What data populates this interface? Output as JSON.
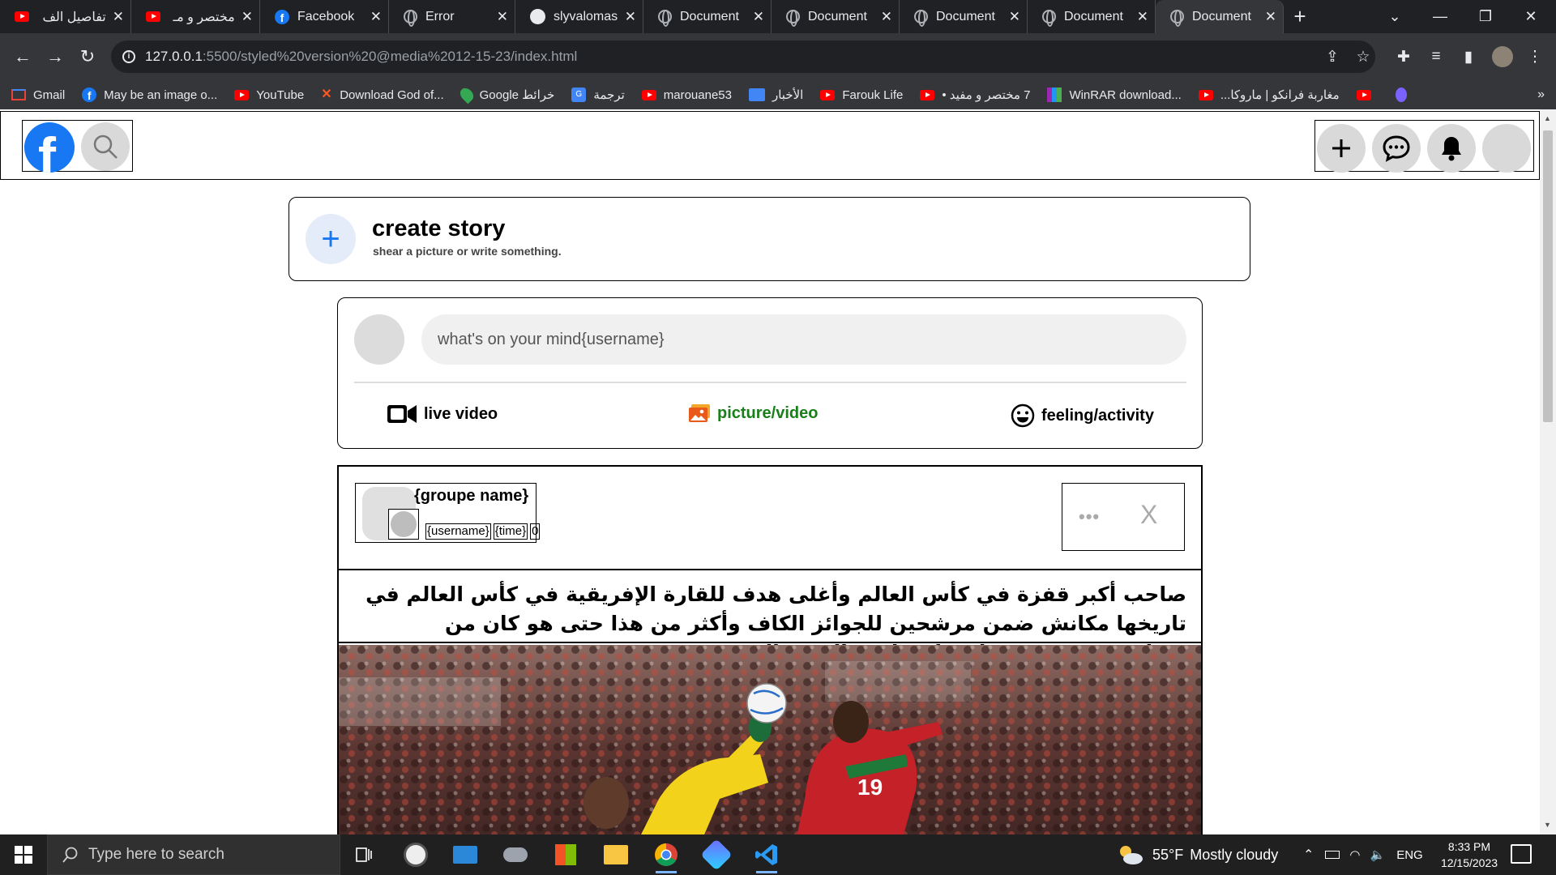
{
  "browser": {
    "tabs": [
      {
        "title": "تفاصيل الف",
        "favicon": "youtube-icon",
        "active": false
      },
      {
        "title": "مختصر و مـ",
        "favicon": "youtube-icon",
        "active": false
      },
      {
        "title": "Facebook",
        "favicon": "facebook-icon",
        "active": false
      },
      {
        "title": "Error",
        "favicon": "globe-icon",
        "active": false
      },
      {
        "title": "slyvalomas",
        "favicon": "github-icon",
        "active": false
      },
      {
        "title": "Document",
        "favicon": "globe-icon",
        "active": false
      },
      {
        "title": "Document",
        "favicon": "globe-icon",
        "active": false
      },
      {
        "title": "Document",
        "favicon": "globe-icon",
        "active": false
      },
      {
        "title": "Document",
        "favicon": "globe-icon",
        "active": false
      },
      {
        "title": "Document",
        "favicon": "globe-icon",
        "active": true
      }
    ],
    "url_host": "127.0.0.1",
    "url_path": ":5500/styled%20version%20@media%2012-15-23/index.html",
    "bookmarks": [
      {
        "label": "Gmail",
        "icon": "gmail-icon"
      },
      {
        "label": "May be an image o...",
        "icon": "facebook-icon"
      },
      {
        "label": "YouTube",
        "icon": "youtube-icon"
      },
      {
        "label": "Download God of...",
        "icon": "download-icon"
      },
      {
        "label": "Google خرائط",
        "icon": "maps-icon"
      },
      {
        "label": "ترجمة",
        "icon": "translate-icon"
      },
      {
        "label": "marouane53",
        "icon": "youtube-icon"
      },
      {
        "label": "الأخبار",
        "icon": "news-icon"
      },
      {
        "label": "Farouk Life",
        "icon": "youtube-icon"
      },
      {
        "label": "7 مختصر و مفيد •",
        "icon": "youtube-icon"
      },
      {
        "label": "WinRAR download...",
        "icon": "winrar-icon"
      },
      {
        "label": "مغاربة فرانكو | ماروكا...",
        "icon": "youtube-icon"
      }
    ],
    "more_bookmarks": "»"
  },
  "header": {
    "logo_letter": "f"
  },
  "story": {
    "plus": "+",
    "title": "create story",
    "subtitle": "shear a picture or write something."
  },
  "composer": {
    "placeholder": "what's on your mind{username}",
    "actions": [
      {
        "label": "live video",
        "color": "#000000"
      },
      {
        "label": "picture/video",
        "color": "#1a7f1a"
      },
      {
        "label": "feeling/activity",
        "color": "#000000"
      }
    ]
  },
  "post": {
    "group_name": "{groupe name}",
    "username": "{username}",
    "time": "{time}",
    "privacy": "0",
    "dots": "•••",
    "close": "X",
    "text": "صاحب أكبر قفزة في كأس العالم وأغلى هدف للقارة الإفريقية في كأس العالم في تاريخها مكانش ضمن مرشحين للجوائز الكاف وأكثر من هذا حتى هو كان من مساهمين في تتويج إشبيلية بلقب اليوروباليغ",
    "jersey_number": "19"
  },
  "taskbar": {
    "search_placeholder": "Type here to search",
    "weather_temp": "55°F",
    "weather_desc": "Mostly cloudy",
    "language": "ENG",
    "time": "8:33 PM",
    "date": "12/15/2023"
  },
  "colors": {
    "facebook_blue": "#1877f2",
    "chrome_dark": "#202124",
    "chrome_toolbar": "#35363a"
  }
}
